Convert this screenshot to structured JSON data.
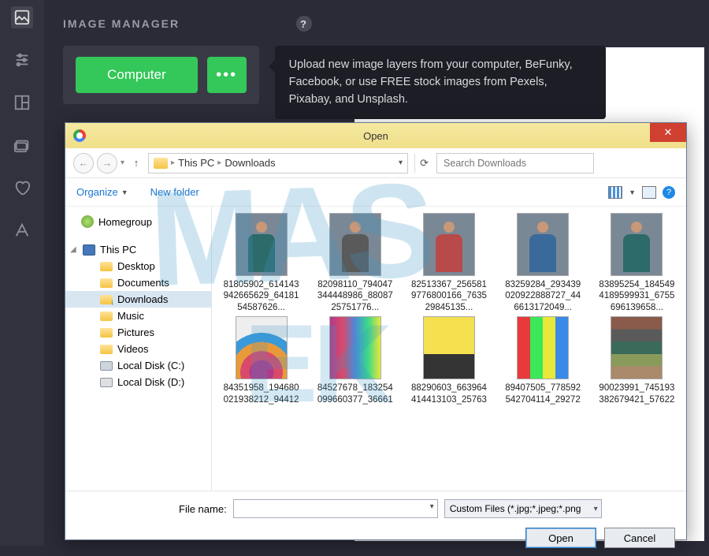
{
  "rail": {
    "items": [
      "image",
      "adjust",
      "layout",
      "element",
      "heart",
      "text"
    ]
  },
  "header": {
    "title": "IMAGE MANAGER",
    "computer_btn": "Computer",
    "more_btn": "•••",
    "tooltip": "Upload new image layers from your computer, BeFunky, Facebook, or use FREE stock images from Pexels, Pixabay, and Unsplash."
  },
  "dialog": {
    "title": "Open",
    "breadcrumb": {
      "root": "This PC",
      "current": "Downloads"
    },
    "search_placeholder": "Search Downloads",
    "organize": "Organize",
    "new_folder": "New folder",
    "tree": {
      "homegroup": "Homegroup",
      "thispc": "This PC",
      "children": [
        {
          "label": "Desktop",
          "icon": "folder"
        },
        {
          "label": "Documents",
          "icon": "folder"
        },
        {
          "label": "Downloads",
          "icon": "folder dl",
          "selected": true
        },
        {
          "label": "Music",
          "icon": "folder"
        },
        {
          "label": "Pictures",
          "icon": "folder"
        },
        {
          "label": "Videos",
          "icon": "folder"
        },
        {
          "label": "Local Disk (C:)",
          "icon": "disk"
        },
        {
          "label": "Local Disk (D:)",
          "icon": "disk d"
        }
      ]
    },
    "files": [
      {
        "name": "81805902_614143942665629_6418154587626...",
        "cls": "person c-teal"
      },
      {
        "name": "82098110_794047344448986_8808725751776...",
        "cls": "person c-gray"
      },
      {
        "name": "82513367_256581977680016​6_763529845135...",
        "cls": "person c-red"
      },
      {
        "name": "83259284_293439020922888727_446613172049...",
        "cls": "person c-blue"
      },
      {
        "name": "83895254_184549418959993​1_6755696139658...",
        "cls": "person c-teal"
      },
      {
        "name": "84351958_194680021938212_94412",
        "cls": "shirt fan"
      },
      {
        "name": "84527678_183254099660377_36661",
        "cls": "shirt rack"
      },
      {
        "name": "88290603_663964414413103_25763",
        "cls": "shirt yellow"
      },
      {
        "name": "89407505_778592542704114_29272",
        "cls": "shirt stripes"
      },
      {
        "name": "90023991_745193382679421_57622",
        "cls": "shirt stack"
      }
    ],
    "filename_label": "File name:",
    "filetype": "Custom Files (*.jpg;*.jpeg;*.png",
    "open_btn": "Open",
    "cancel_btn": "Cancel"
  },
  "watermark": {
    "line1": "MAS",
    "line2": "EK"
  }
}
